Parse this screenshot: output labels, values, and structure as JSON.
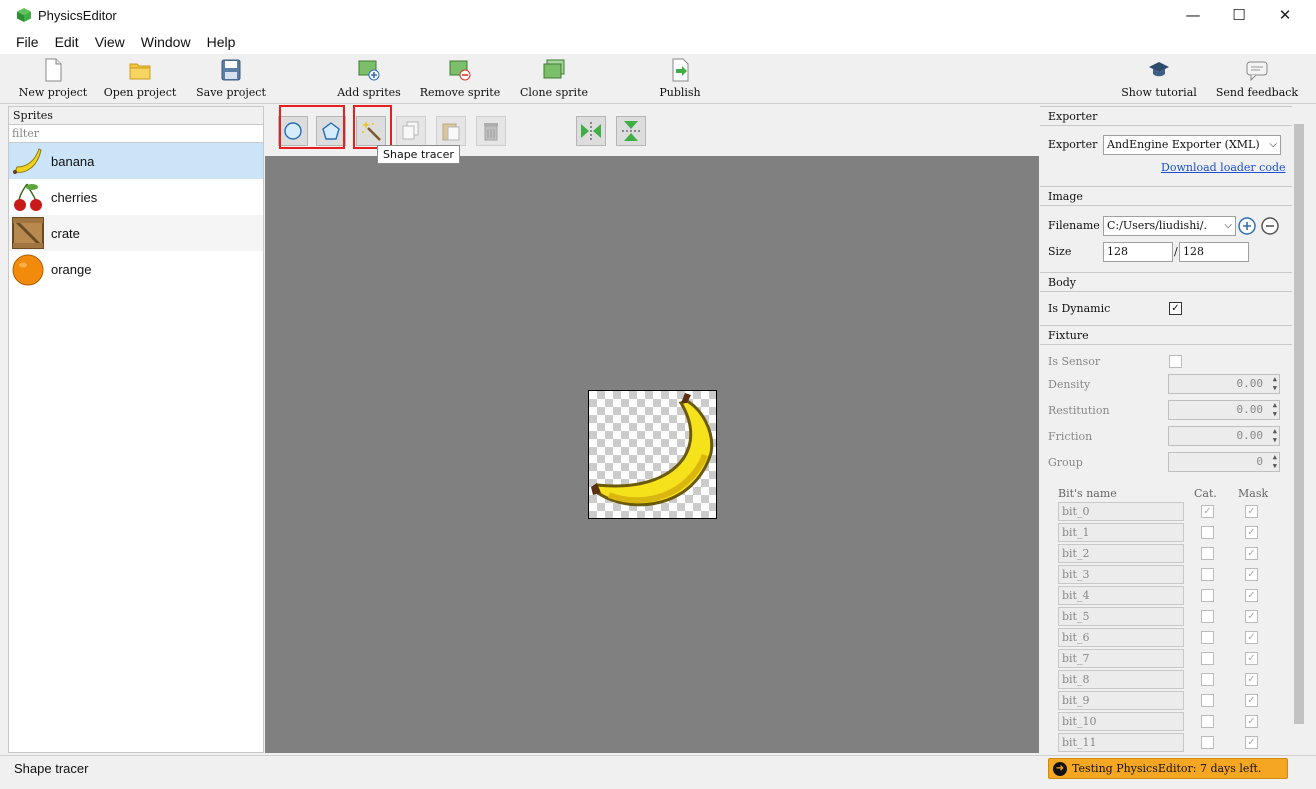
{
  "window": {
    "title": "PhysicsEditor",
    "controls": {
      "minimize": "—",
      "maximize": "☐",
      "close": "✕"
    }
  },
  "menu": [
    "File",
    "Edit",
    "View",
    "Window",
    "Help"
  ],
  "toolbar": {
    "new_project": "New project",
    "open_project": "Open project",
    "save_project": "Save project",
    "add_sprites": "Add sprites",
    "remove_sprite": "Remove sprite",
    "clone_sprite": "Clone sprite",
    "publish": "Publish",
    "show_tutorial": "Show tutorial",
    "send_feedback": "Send feedback"
  },
  "sprites_panel": {
    "header": "Sprites",
    "filter_placeholder": "filter",
    "items": [
      {
        "label": "banana",
        "icon": "banana-icon",
        "selected": true
      },
      {
        "label": "cherries",
        "icon": "cherries-icon"
      },
      {
        "label": "crate",
        "icon": "crate-icon"
      },
      {
        "label": "orange",
        "icon": "orange-icon"
      }
    ]
  },
  "editor_tools": {
    "circle": "circle-tool-icon",
    "polygon": "polygon-tool-icon",
    "shape_tracer": "magic-wand-icon",
    "tooltip": "Shape tracer"
  },
  "exporter": {
    "section": "Exporter",
    "label": "Exporter",
    "value": "AndEngine Exporter (XML)",
    "download_link": "Download loader code"
  },
  "image": {
    "section": "Image",
    "filename_label": "Filename",
    "filename_value": "C:/Users/liudishi/.",
    "size_label": "Size",
    "width": "128",
    "height": "128"
  },
  "body": {
    "section": "Body",
    "is_dynamic_label": "Is Dynamic",
    "is_dynamic": true
  },
  "fixture": {
    "section": "Fixture",
    "is_sensor_label": "Is Sensor",
    "density_label": "Density",
    "density": "0.00",
    "restitution_label": "Restitution",
    "restitution": "0.00",
    "friction_label": "Friction",
    "friction": "0.00",
    "group_label": "Group",
    "group": "0",
    "bits_header": {
      "name": "Bit's name",
      "cat": "Cat.",
      "mask": "Mask"
    },
    "bits": [
      "bit_0",
      "bit_1",
      "bit_2",
      "bit_3",
      "bit_4",
      "bit_5",
      "bit_6",
      "bit_7",
      "bit_8",
      "bit_9",
      "bit_10",
      "bit_11"
    ]
  },
  "status": {
    "text": "Shape tracer",
    "trial": "Testing PhysicsEditor: 7 days left."
  }
}
